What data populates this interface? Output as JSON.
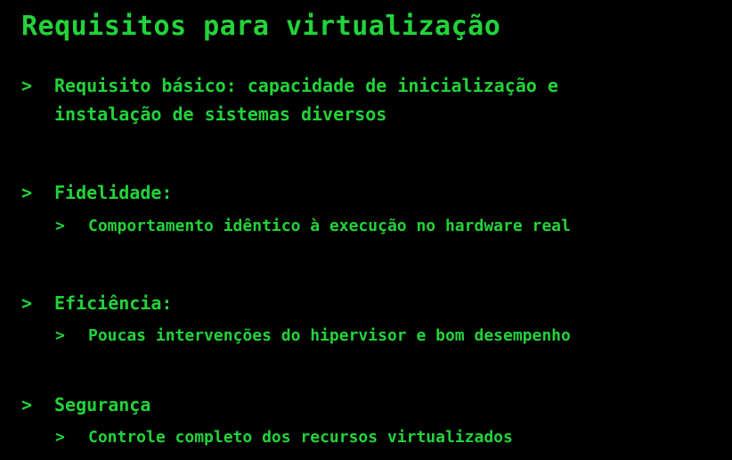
{
  "title": "Requisitos para virtualização",
  "bullet_glyph": ">",
  "items": [
    {
      "text_line1": "Requisito básico: capacidade de inicialização e",
      "text_line2": "instalação de sistemas diversos"
    },
    {
      "text": "Fidelidade:",
      "sub": "Comportamento idêntico à execução no hardware real"
    },
    {
      "text": "Eficiência:",
      "sub": "Poucas intervenções do hipervisor e bom desempenho"
    },
    {
      "text": "Segurança",
      "sub": "Controle completo dos recursos virtualizados"
    }
  ],
  "colors": {
    "background": "#000000",
    "text": "#22d33a"
  }
}
